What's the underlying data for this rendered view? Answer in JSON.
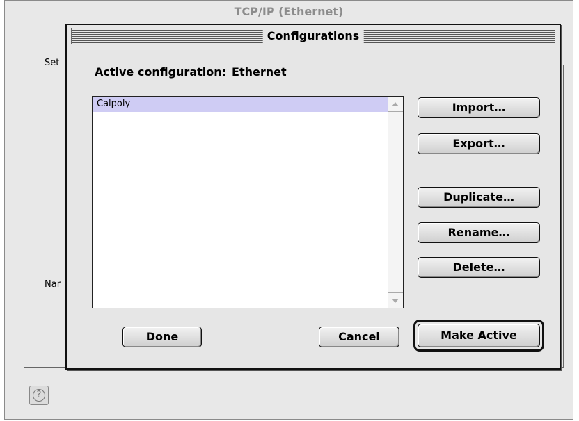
{
  "background_window": {
    "title": "TCP/IP (Ethernet)",
    "group_label": "Set",
    "name_label": "Nar",
    "help_icon": "question-mark-icon"
  },
  "dialog": {
    "title": "Configurations",
    "active_label": "Active configuration:",
    "active_value": "Ethernet",
    "list": {
      "items": [
        {
          "label": "Calpoly",
          "selected": true
        }
      ]
    },
    "buttons": {
      "import": "Import…",
      "export": "Export…",
      "duplicate": "Duplicate…",
      "rename": "Rename…",
      "delete": "Delete…",
      "done": "Done",
      "cancel": "Cancel",
      "make_active": "Make Active"
    }
  },
  "colors": {
    "selection": "#cfccf4",
    "dialog_bg": "#e6e6e6"
  }
}
